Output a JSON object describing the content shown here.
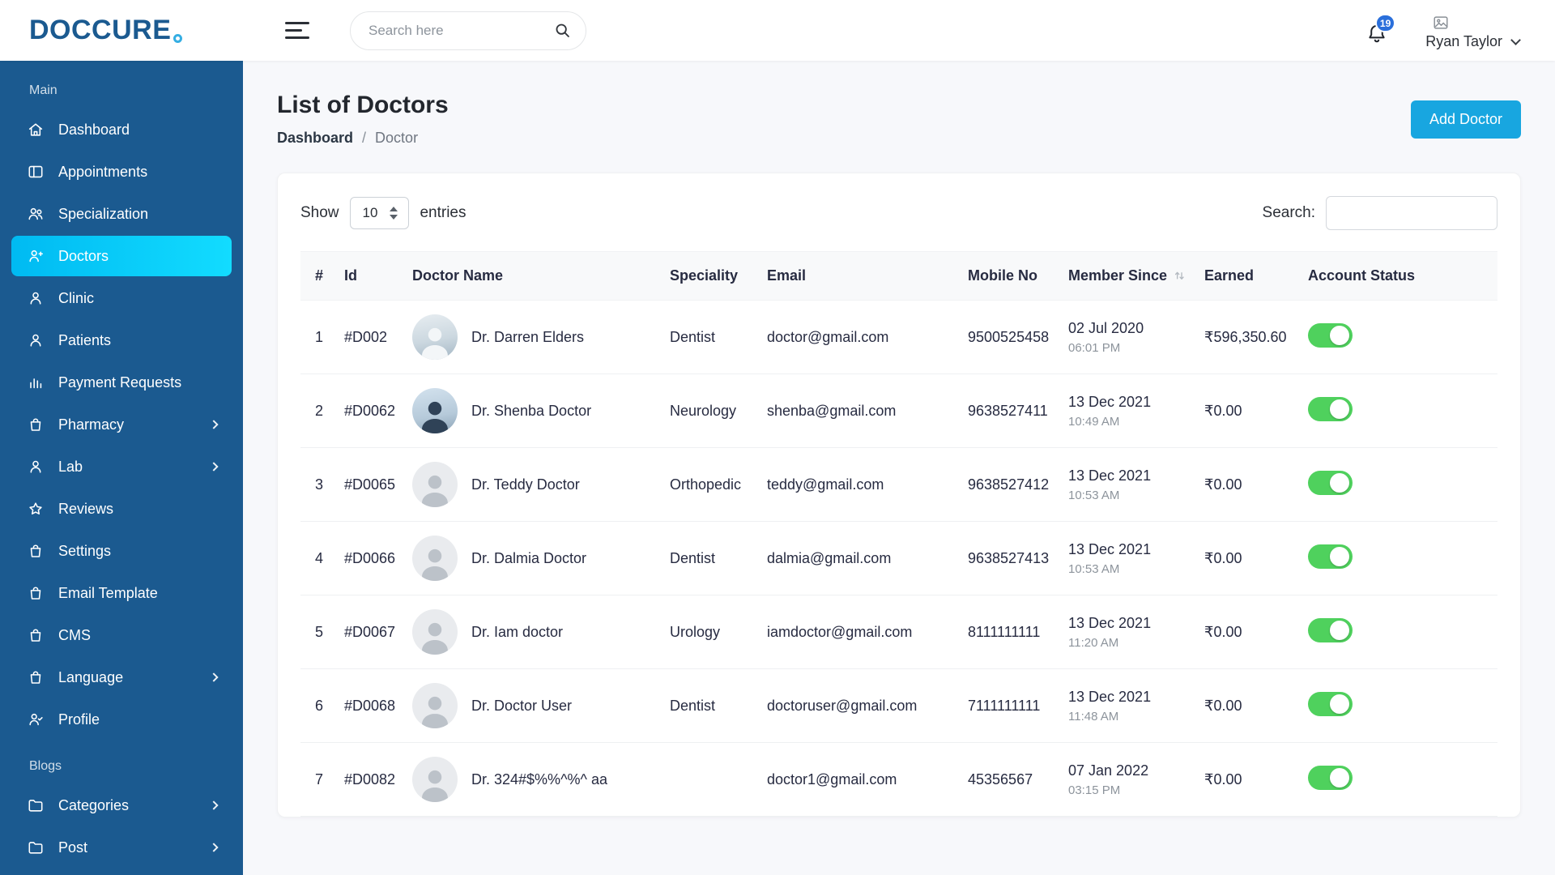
{
  "theme": {
    "logo": "#1b5a90",
    "sidebar_bg": "#1b5a90",
    "active_from": "#00baf2",
    "active_to": "#12dcff",
    "accent_button": "#18a6e0",
    "toggle_on": "#4fd15d",
    "badge": "#2a6fdb"
  },
  "header": {
    "logo_text": "DOCCURE",
    "search_placeholder": "Search here",
    "notification_badge": "19",
    "user_name": "Ryan Taylor"
  },
  "sidebar": {
    "section_main": "Main",
    "section_blogs": "Blogs",
    "items": {
      "dashboard": "Dashboard",
      "appointments": "Appointments",
      "specialization": "Specialization",
      "doctors": "Doctors",
      "clinic": "Clinic",
      "patients": "Patients",
      "payment_requests": "Payment Requests",
      "pharmacy": "Pharmacy",
      "lab": "Lab",
      "reviews": "Reviews",
      "settings": "Settings",
      "email_template": "Email Template",
      "cms": "CMS",
      "language": "Language",
      "profile": "Profile",
      "categories": "Categories",
      "post": "Post"
    }
  },
  "page": {
    "title": "List of Doctors",
    "breadcrumb": {
      "root": "Dashboard",
      "separator": "/",
      "current": "Doctor"
    },
    "add_button": "Add Doctor"
  },
  "table": {
    "show_label": "Show",
    "page_size": "10",
    "entries_label": "entries",
    "search_label": "Search:",
    "search_value": "",
    "columns": [
      "#",
      "Id",
      "Doctor Name",
      "Speciality",
      "Email",
      "Mobile No",
      "Member Since",
      "Earned",
      "Account Status"
    ],
    "rows": [
      {
        "num": "1",
        "id": "#D002",
        "name": "Dr. Darren Elders",
        "avatar": "photo-a",
        "speciality": "Dentist",
        "email": "doctor@gmail.com",
        "mobile": "9500525458",
        "member_date": "02 Jul 2020",
        "member_time": "06:01 PM",
        "earned": "₹596,350.60",
        "status": "on"
      },
      {
        "num": "2",
        "id": "#D0062",
        "name": "Dr. Shenba Doctor",
        "avatar": "photo-b",
        "speciality": "Neurology",
        "email": "shenba@gmail.com",
        "mobile": "9638527411",
        "member_date": "13 Dec 2021",
        "member_time": "10:49 AM",
        "earned": "₹0.00",
        "status": "on"
      },
      {
        "num": "3",
        "id": "#D0065",
        "name": "Dr. Teddy Doctor",
        "avatar": "placeholder",
        "speciality": "Orthopedic",
        "email": "teddy@gmail.com",
        "mobile": "9638527412",
        "member_date": "13 Dec 2021",
        "member_time": "10:53 AM",
        "earned": "₹0.00",
        "status": "on"
      },
      {
        "num": "4",
        "id": "#D0066",
        "name": "Dr. Dalmia Doctor",
        "avatar": "placeholder",
        "speciality": "Dentist",
        "email": "dalmia@gmail.com",
        "mobile": "9638527413",
        "member_date": "13 Dec 2021",
        "member_time": "10:53 AM",
        "earned": "₹0.00",
        "status": "on"
      },
      {
        "num": "5",
        "id": "#D0067",
        "name": "Dr. Iam doctor",
        "avatar": "placeholder",
        "speciality": "Urology",
        "email": "iamdoctor@gmail.com",
        "mobile": "8111111111",
        "member_date": "13 Dec 2021",
        "member_time": "11:20 AM",
        "earned": "₹0.00",
        "status": "on"
      },
      {
        "num": "6",
        "id": "#D0068",
        "name": "Dr. Doctor User",
        "avatar": "placeholder",
        "speciality": "Dentist",
        "email": "doctoruser@gmail.com",
        "mobile": "7111111111",
        "member_date": "13 Dec 2021",
        "member_time": "11:48 AM",
        "earned": "₹0.00",
        "status": "on"
      },
      {
        "num": "7",
        "id": "#D0082",
        "name": "Dr. 324#$%%^%^ aa",
        "avatar": "placeholder",
        "speciality": "",
        "email": "doctor1@gmail.com",
        "mobile": "45356567",
        "member_date": "07 Jan 2022",
        "member_time": "03:15 PM",
        "earned": "₹0.00",
        "status": "on"
      }
    ]
  }
}
